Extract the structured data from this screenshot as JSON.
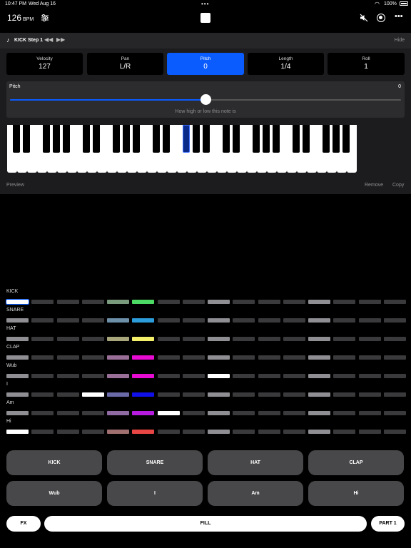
{
  "status": {
    "time": "10:47 PM",
    "date": "Wed Aug 16",
    "battery": "100%"
  },
  "topbar": {
    "bpm_value": "126",
    "bpm_unit": "BPM"
  },
  "editor": {
    "step_title": "KICK Step 1",
    "hide_label": "Hide",
    "params": [
      {
        "label": "Velocity",
        "value": "127",
        "active": false
      },
      {
        "label": "Pan",
        "value": "L/R",
        "active": false
      },
      {
        "label": "Pitch",
        "value": "0",
        "active": true
      },
      {
        "label": "Length",
        "value": "1/4",
        "active": false
      },
      {
        "label": "Roll",
        "value": "1",
        "active": false
      }
    ],
    "pitch": {
      "label": "Pitch",
      "value": "0",
      "hint": "How high or low this note is",
      "slider_fraction": 0.5
    },
    "keyboard": {
      "white_keys": 35,
      "selected_black_key_index": 12
    },
    "preview_label": "Preview",
    "remove_label": "Remove",
    "copy_label": "Copy"
  },
  "sequencer": {
    "tracks": [
      {
        "name": "KICK",
        "steps": [
          "sel",
          "off",
          "off",
          "off",
          "muted-green",
          "green",
          "off",
          "off",
          "bar",
          "off",
          "off",
          "off",
          "bar",
          "off",
          "off",
          "off"
        ]
      },
      {
        "name": "SNARE",
        "steps": [
          "bar",
          "off",
          "off",
          "off",
          "muted-blue",
          "blue",
          "off",
          "off",
          "bar",
          "off",
          "off",
          "off",
          "bar",
          "off",
          "off",
          "off"
        ]
      },
      {
        "name": "HAT",
        "steps": [
          "bar",
          "off",
          "off",
          "off",
          "muted-yellow",
          "yellow",
          "off",
          "off",
          "bar",
          "off",
          "off",
          "off",
          "bar",
          "off",
          "off",
          "off"
        ]
      },
      {
        "name": "CLAP",
        "steps": [
          "bar",
          "off",
          "off",
          "off",
          "muted-magenta",
          "magenta",
          "off",
          "off",
          "bar",
          "off",
          "off",
          "off",
          "bar",
          "off",
          "off",
          "off"
        ]
      },
      {
        "name": "Wub",
        "steps": [
          "bar",
          "off",
          "off",
          "off",
          "muted-magenta",
          "magenta",
          "off",
          "off",
          "white",
          "off",
          "off",
          "off",
          "bar",
          "off",
          "off",
          "off"
        ]
      },
      {
        "name": "I",
        "steps": [
          "bar",
          "off",
          "off",
          "white",
          "muted-indigo",
          "indigo",
          "off",
          "off",
          "bar",
          "off",
          "off",
          "off",
          "bar",
          "off",
          "off",
          "off"
        ]
      },
      {
        "name": "Am",
        "steps": [
          "bar",
          "off",
          "off",
          "off",
          "muted-purple",
          "purple",
          "white",
          "off",
          "bar",
          "off",
          "off",
          "off",
          "bar",
          "off",
          "off",
          "off"
        ]
      },
      {
        "name": "Hi",
        "steps": [
          "white",
          "off",
          "off",
          "off",
          "muted-red",
          "red",
          "off",
          "off",
          "bar",
          "off",
          "off",
          "off",
          "bar",
          "off",
          "off",
          "off"
        ]
      }
    ],
    "colors": {
      "off": "#3a3a3c",
      "bar": "#8e8e93",
      "white": "#ffffff",
      "sel": "#ffffff",
      "green": "#4cd964",
      "muted-green": "#7a9a7e",
      "blue": "#2d9cdb",
      "muted-blue": "#6d8fa8",
      "yellow": "#f5f06a",
      "muted-yellow": "#a8a67a",
      "magenta": "#e80bd2",
      "muted-magenta": "#9a6f97",
      "indigo": "#1010e8",
      "muted-indigo": "#6a6aa8",
      "purple": "#b51ce0",
      "muted-purple": "#8f6aa3",
      "red": "#e84545",
      "muted-red": "#a07070"
    }
  },
  "pads": [
    "KICK",
    "SNARE",
    "HAT",
    "CLAP",
    "Wub",
    "I",
    "Am",
    "Hi"
  ],
  "bottom": {
    "fx_label": "FX",
    "fill_label": "FILL",
    "part_label": "PART 1"
  }
}
